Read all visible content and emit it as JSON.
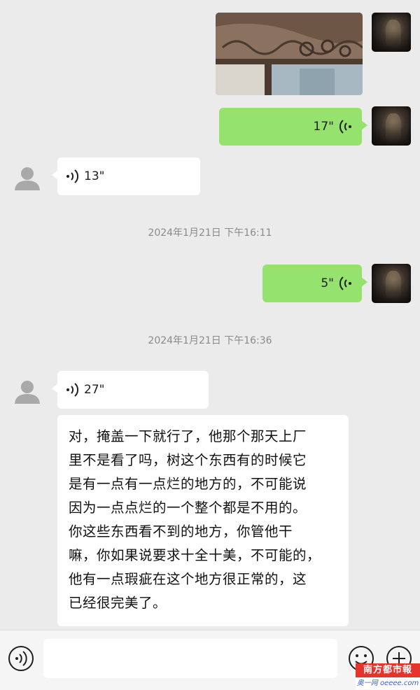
{
  "messages": {
    "voice_out_1": {
      "duration": "17\""
    },
    "voice_in_1": {
      "duration": "13\""
    },
    "voice_out_2": {
      "duration": "5\""
    },
    "voice_in_2": {
      "duration": "27\""
    },
    "text_in_1": {
      "lines": [
        "对，掩盖一下就行了，他那个那天上厂",
        "里不是看了吗，树这个东西有的时候它",
        "是有一点有一点烂的地方的，不可能说",
        "因为一点点烂的一个整个都是不用的。",
        "你这些东西看不到的地方，你管他干",
        "嘛，你如果说要求十全十美，不可能的，",
        "他有一点瑕疵在这个地方很正常的，这",
        "已经很完美了。"
      ]
    }
  },
  "timestamps": {
    "ts_1": "2024年1月21日 下午16:11",
    "ts_2": "2024年1月21日 下午16:36"
  },
  "input_bar": {
    "voice_toggle_icon": "voice-wave-icon",
    "emoji_icon": "emoji-icon",
    "more_icon": "plus-icon"
  },
  "watermark": {
    "top": "南方都市報",
    "bottom": "奥一网 oeeee.com"
  },
  "colors": {
    "bubble_out": "#95e26e",
    "bubble_in": "#ffffff",
    "chat_bg": "#ebebeb",
    "timestamp": "#8a8a8a",
    "watermark_red": "#e5342b"
  }
}
